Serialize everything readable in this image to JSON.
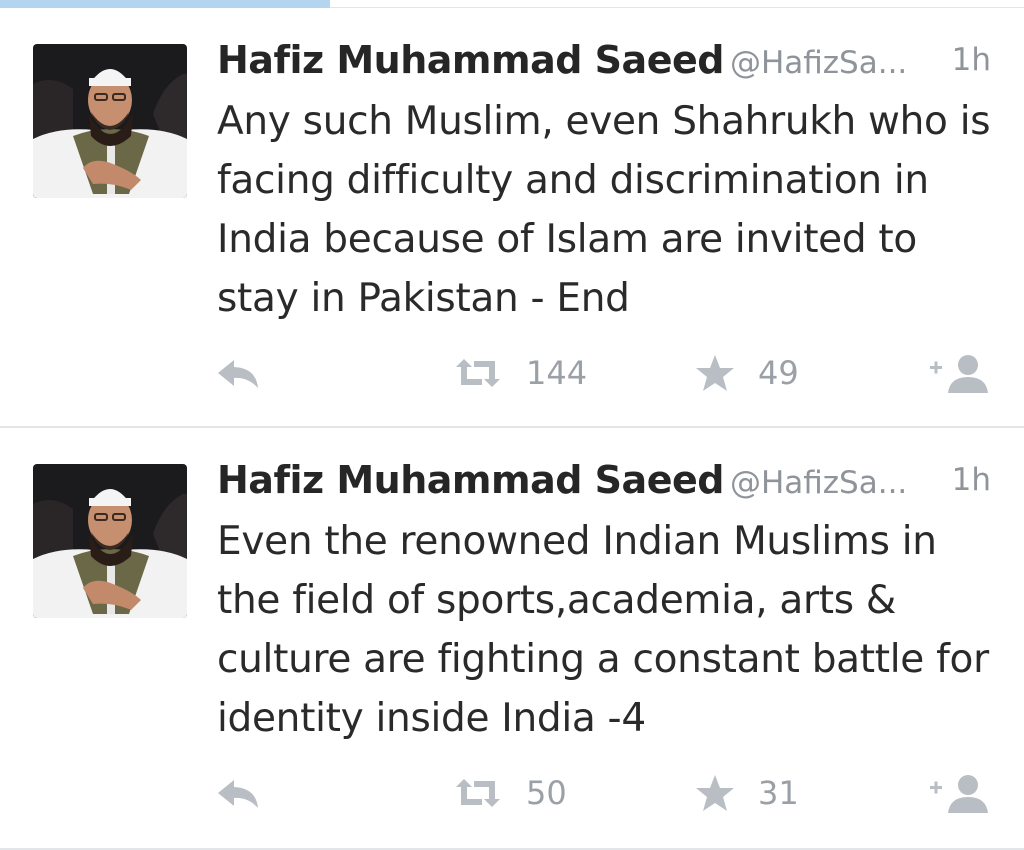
{
  "tweets": [
    {
      "author_name": "Hafiz Muhammad Saeed",
      "author_handle": "@HafizSa...",
      "time": "1h",
      "text": "Any such Muslim, even Shahrukh who is facing difficulty and discrimination in India because of Islam are invited to stay in Pakistan - End",
      "retweets": "144",
      "favorites": "49"
    },
    {
      "author_name": "Hafiz Muhammad Saeed",
      "author_handle": "@HafizSa...",
      "time": "1h",
      "text": "Even the renowned Indian Muslims in the field of sports,academia, arts & culture are fighting a constant battle for identity inside India -4",
      "retweets": "50",
      "favorites": "31"
    }
  ],
  "icons": {
    "reply": "reply-icon",
    "retweet": "retweet-icon",
    "favorite": "star-icon",
    "follow": "add-user-icon"
  },
  "colors": {
    "name": "#262626",
    "meta": "#8f949a",
    "action": "#b8bec4",
    "divider": "#e3e6e9",
    "tab_indicator": "#b4d5f0"
  }
}
